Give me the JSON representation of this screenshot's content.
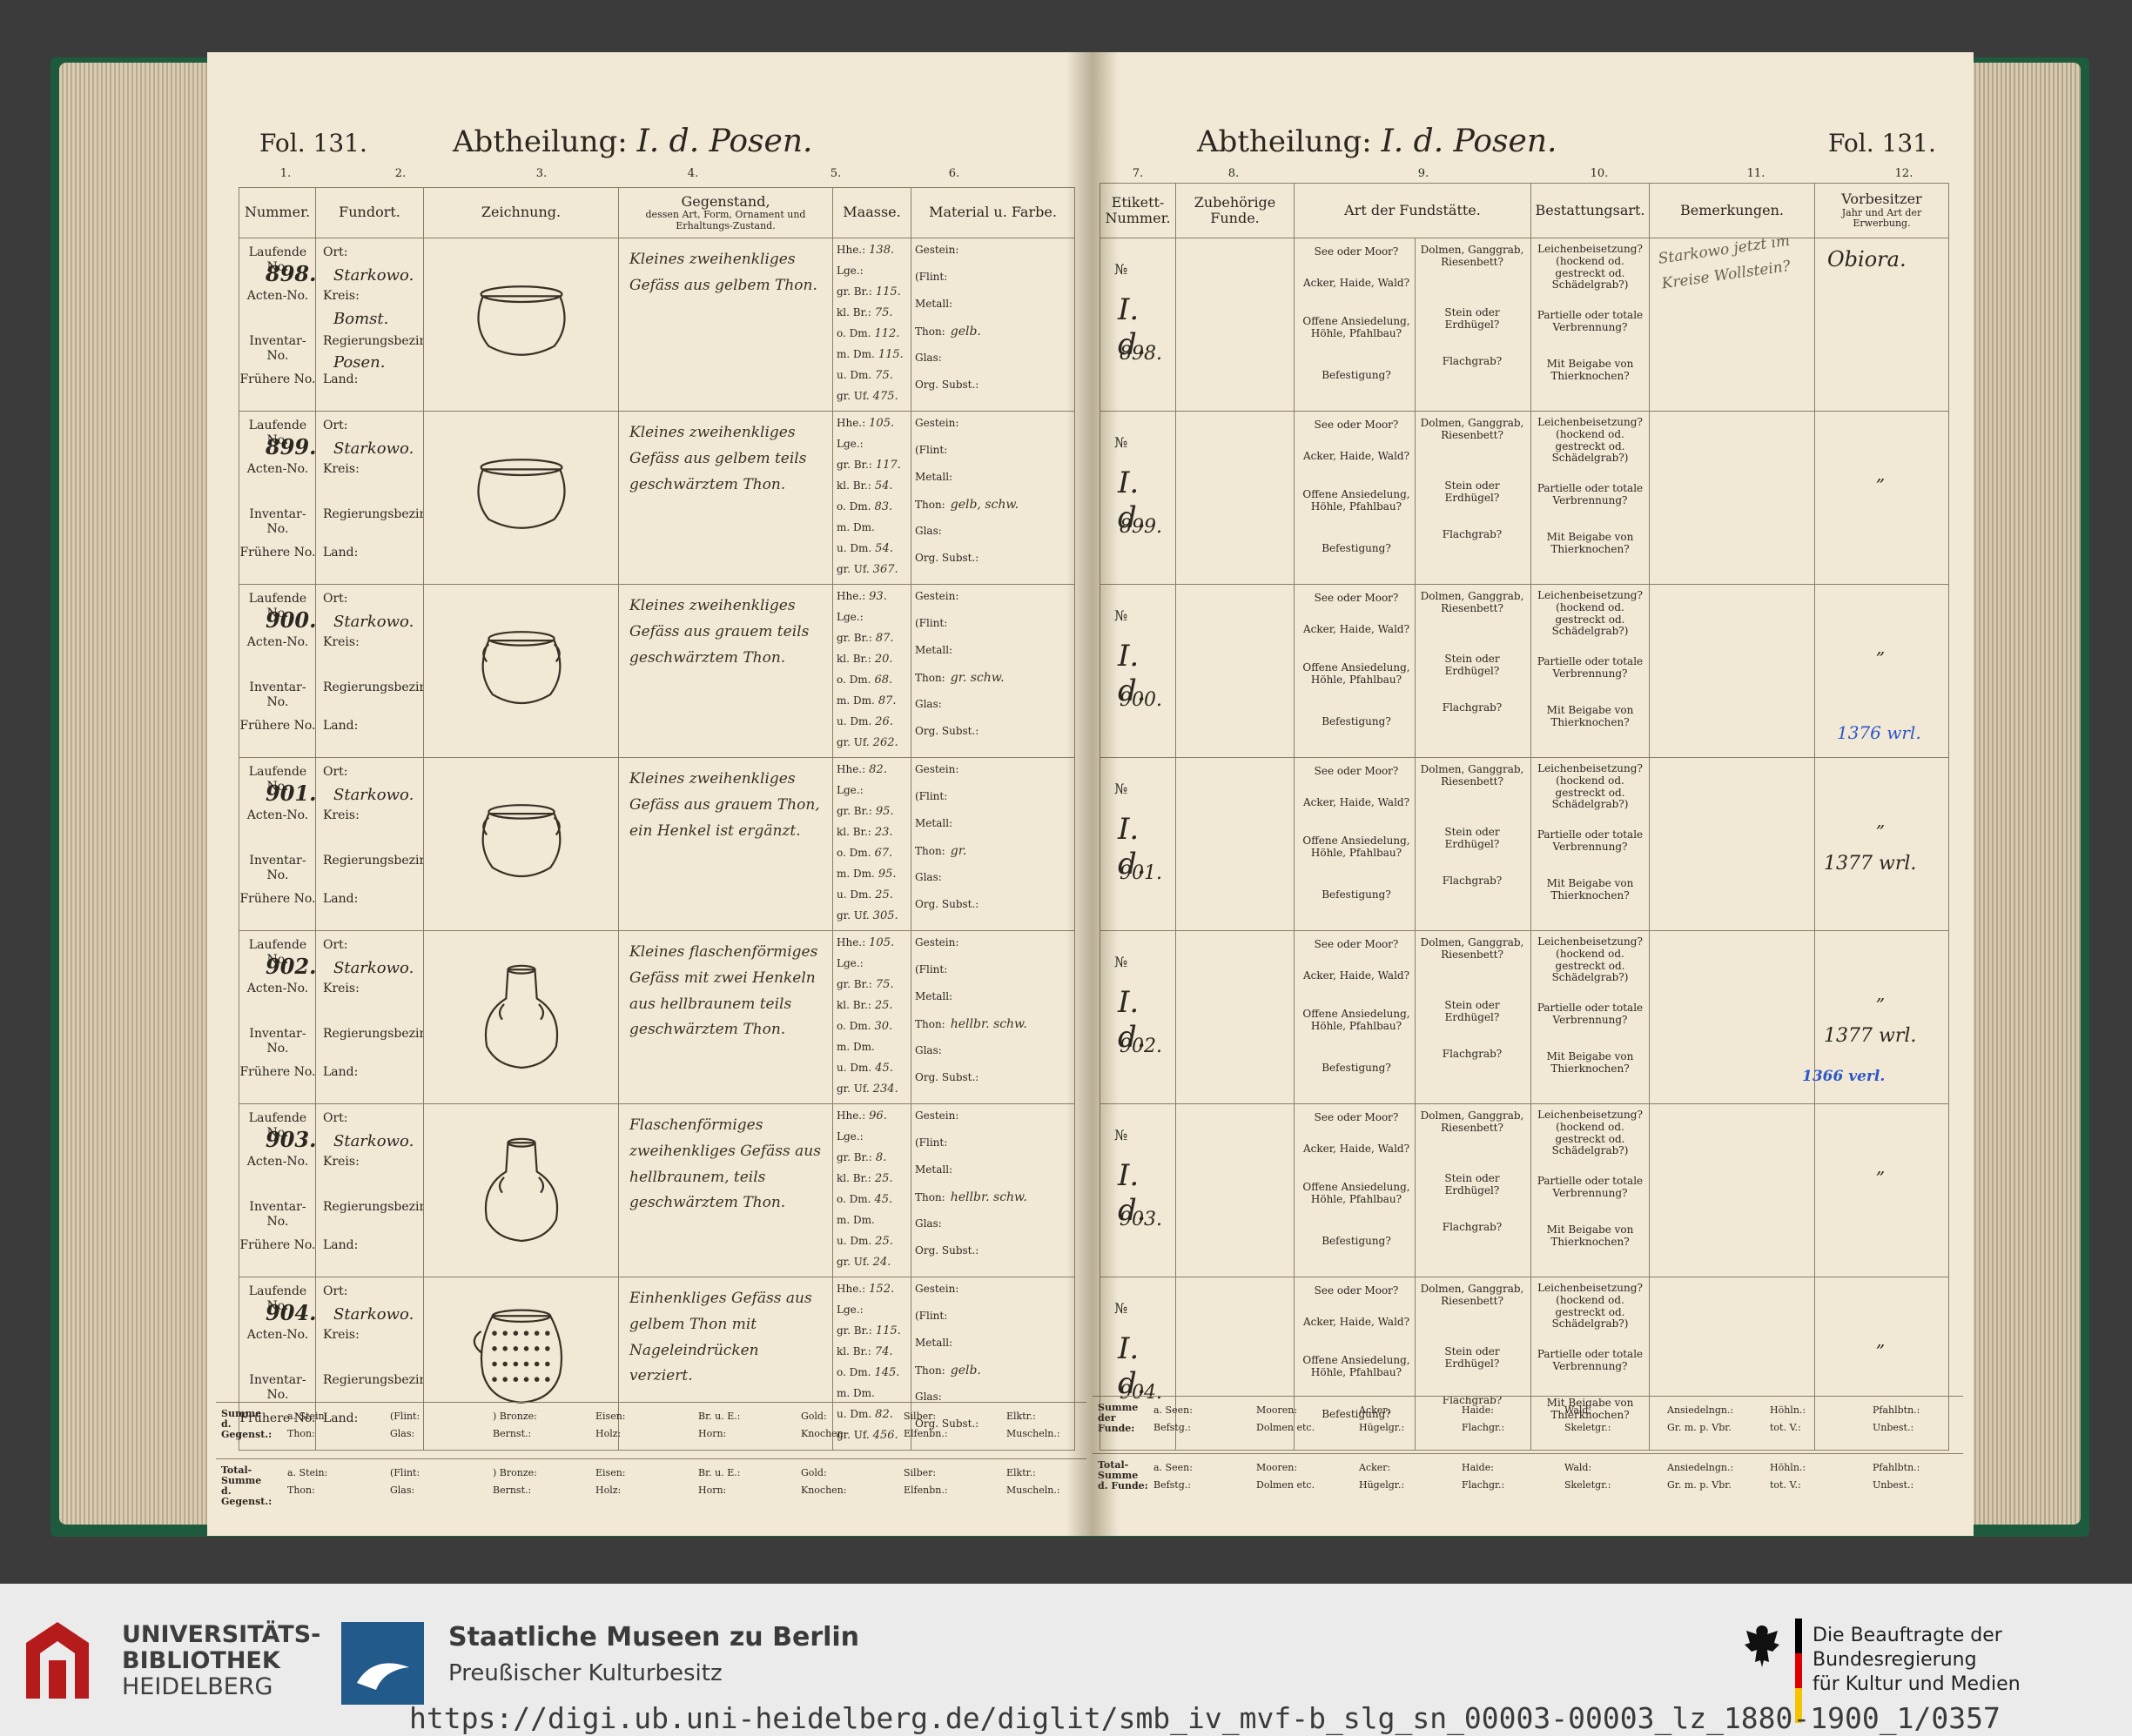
{
  "left_page": {
    "folio": "Fol. 131.",
    "abtheilung_label": "Abtheilung:",
    "abtheilung_value": "I. d. Posen.",
    "column_numbers": [
      "1.",
      "2.",
      "3.",
      "4.",
      "5.",
      "6."
    ],
    "headers": {
      "nummer": "Nummer.",
      "fundort": "Fundort.",
      "zeichnung": "Zeichnung.",
      "gegenstand": "Gegenstand,",
      "gegenstand_sub": "dessen Art, Form, Ornament und Erhaltungs-Zustand.",
      "maasse": "Maasse.",
      "material": "Material u. Farbe."
    }
  },
  "right_page": {
    "folio": "Fol. 131.",
    "abtheilung_label": "Abtheilung:",
    "abtheilung_value": "I. d. Posen.",
    "column_numbers": [
      "7.",
      "8.",
      "9.",
      "10.",
      "11.",
      "12."
    ],
    "headers": {
      "etikett": "Etikett-Nummer.",
      "zubehoerige": "Zubehörige Funde.",
      "art": "Art der Fundstätte.",
      "bestattung": "Bestattungsart.",
      "bemerkungen": "Bemerkungen.",
      "vorbesitzer": "Vorbesitzer",
      "vorbesitzer_sub": "Jahr und Art der Erwerbung."
    }
  },
  "row_labels": {
    "laufende": "Laufende No.",
    "acten": "Acten-No.",
    "inventar": "Inventar-No.",
    "fruehere": "Frühere No.",
    "ort": "Ort:",
    "kreis": "Kreis:",
    "regbez": "Regierungsbezirk:",
    "land": "Land:"
  },
  "maasse_labels": [
    "Hhe.:",
    "Lge.:",
    "gr. Br.:",
    "kl. Br.:",
    "o. Dm.",
    "m. Dm.",
    "u. Dm.",
    "gr. Uf."
  ],
  "material_labels": [
    "Gestein:",
    "(Flint:",
    "Metall:",
    "Thon:",
    "Glas:",
    "Org. Subst.:"
  ],
  "art_labels": [
    "See oder Moor?",
    "Acker, Haide, Wald?",
    "Offene Ansiedelung, Höhle, Pfahlbau?",
    "Befestigung?"
  ],
  "art_labels2": [
    "Dolmen, Ganggrab, Riesenbett?",
    "Stein oder Erdhügel?",
    "Flachgrab?"
  ],
  "best_labels": [
    "Leichenbeisetzung? (hockend od. gestreckt od. Schädelgrab?)",
    "Partielle oder totale Verbrennung?",
    "Mit Beigabe von Thierknochen?"
  ],
  "etikett_prefix": "№",
  "etikett_code": "I. d.",
  "entries": [
    {
      "nr": "898.",
      "ort": "Starkowo.",
      "kreis": "Bomst.",
      "regbez": "Posen.",
      "desc": "Kleines zweihenkliges Gefäss aus gelbem Thon.",
      "maasse": [
        "138.",
        "",
        "115.",
        "75.",
        "112.",
        "115.",
        "75.",
        "475."
      ],
      "thon": "gelb.",
      "etikett_nr": "898.",
      "bemerkung": "Starkowo jetzt im Kreise Wollstein?",
      "vorbesitzer": "Obiora."
    },
    {
      "nr": "899.",
      "ort": "Starkowo.",
      "kreis": "",
      "regbez": "",
      "desc": "Kleines zweihenkliges Gefäss aus gelbem teils geschwärztem Thon.",
      "maasse": [
        "105.",
        "",
        "117.",
        "54.",
        "83.",
        "",
        "54.",
        "367."
      ],
      "thon": "gelb, schw.",
      "etikett_nr": "899.",
      "bemerkung": "",
      "vorbesitzer": "„"
    },
    {
      "nr": "900.",
      "ort": "Starkowo.",
      "kreis": "",
      "regbez": "",
      "desc": "Kleines zweihenkliges Gefäss aus grauem teils geschwärztem Thon.",
      "maasse": [
        "93.",
        "",
        "87.",
        "20.",
        "68.",
        "87.",
        "26.",
        "262."
      ],
      "thon": "gr. schw.",
      "etikett_nr": "900.",
      "bemerkung": "",
      "vorbesitzer": "„"
    },
    {
      "nr": "901.",
      "ort": "Starkowo.",
      "kreis": "",
      "regbez": "",
      "desc": "Kleines zweihenkliges Gefäss aus grauem Thon, ein Henkel ist ergänzt.",
      "maasse": [
        "82.",
        "",
        "95.",
        "23.",
        "67.",
        "95.",
        "25.",
        "305."
      ],
      "thon": "gr.",
      "etikett_nr": "901.",
      "bemerkung": "",
      "vorbesitzer": "„"
    },
    {
      "nr": "902.",
      "ort": "Starkowo.",
      "kreis": "",
      "regbez": "",
      "desc": "Kleines flaschenförmiges Gefäss mit zwei Henkeln aus hellbraunem teils geschwärztem Thon.",
      "maasse": [
        "105.",
        "",
        "75.",
        "25.",
        "30.",
        "",
        "45.",
        "234."
      ],
      "thon": "hellbr. schw.",
      "etikett_nr": "902.",
      "bemerkung": "",
      "vorbesitzer": "„"
    },
    {
      "nr": "903.",
      "ort": "Starkowo.",
      "kreis": "",
      "regbez": "",
      "desc": "Flaschenförmiges zweihenkliges Gefäss aus hellbraunem, teils geschwärztem Thon.",
      "maasse": [
        "96.",
        "",
        "8.",
        "25.",
        "45.",
        "",
        "25.",
        "24."
      ],
      "thon": "hellbr. schw.",
      "etikett_nr": "903.",
      "bemerkung": "",
      "vorbesitzer": "„"
    },
    {
      "nr": "904.",
      "ort": "Starkowo.",
      "kreis": "",
      "regbez": "",
      "desc": "Einhenkliges Gefäss aus gelbem Thon mit Nageleindrücken verziert.",
      "maasse": [
        "152.",
        "",
        "115.",
        "74.",
        "145.",
        "",
        "82.",
        "456."
      ],
      "thon": "gelb.",
      "etikett_nr": "904.",
      "bemerkung": "",
      "vorbesitzer": "„"
    }
  ],
  "margin_notes": [
    "1376 wrl.",
    "1377 wrl.",
    "1377 wrl.",
    "1366 verl."
  ],
  "summe_left": {
    "label1": "Summe d. Gegenst.:",
    "row1": [
      "a. Stein:",
      "(Flint:",
      ") Bronze:",
      "Eisen:",
      "Br. u. E.:",
      "Gold:",
      "Silber:",
      "Elktr.:"
    ],
    "row2": [
      "Thon:",
      "Glas:",
      "Bernst.:",
      "Holz:",
      "Horn:",
      "Knochen:",
      "Elfenbn.:",
      "Muscheln.:"
    ],
    "label2": "Total-Summe d. Gegenst.:"
  },
  "summe_right": {
    "label1": "Summe der Funde:",
    "row1": [
      "a. Seen:",
      "Mooren:",
      "Acker:",
      "Haide:",
      "Wald:",
      "Ansiedelngn.:",
      "Höhln.:",
      "Pfahlbtn.:"
    ],
    "row2": [
      "Befstg.:",
      "Dolmen etc.",
      "Hügelgr.:",
      "Flachgr.:",
      "Skeletgr.:",
      "Gr. m. p. Vbr.",
      "tot. V.:",
      "Unbest.:"
    ],
    "label2": "Total-Summe d. Funde:"
  },
  "footer": {
    "uni_line1": "UNIVERSITÄTS-",
    "uni_line2": "BIBLIOTHEK",
    "uni_line3": "HEIDELBERG",
    "smb_title": "Staatliche Museen zu Berlin",
    "smb_sub": "Preußischer Kulturbesitz",
    "bkm_line1": "Die Beauftragte der Bundesregierung",
    "bkm_line2": "für Kultur und Medien",
    "url": "https://digi.ub.uni-heidelberg.de/diglit/smb_iv_mvf-b_slg_sn_00003-00003_lz_1880-1900_1/0357"
  }
}
